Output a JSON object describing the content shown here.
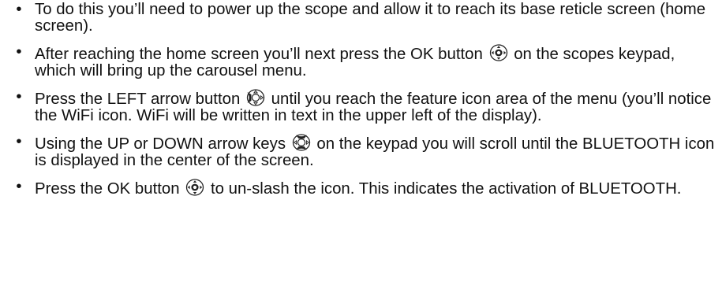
{
  "steps": [
    {
      "before": "To do this you’ll need to power up the scope and allow it to reach its base reticle screen (home screen).",
      "icon": null,
      "after": ""
    },
    {
      "before": "After reaching the home screen you’ll next press the OK button ",
      "icon": "keypad-ok-icon",
      "after": " on the scopes keypad, which will bring up the carousel menu."
    },
    {
      "before": "Press the LEFT arrow button ",
      "icon": "keypad-left-icon",
      "after": " until you reach the feature icon area of the menu (you’ll notice the WiFi icon. WiFi will be written in text in the upper left of the display)."
    },
    {
      "before": "Using the UP or DOWN arrow keys ",
      "icon": "keypad-up-down-icon",
      "after": " on the keypad you will scroll until the BLUETOOTH icon is displayed in the center of the screen."
    },
    {
      "before": "Press the OK button ",
      "icon": "keypad-ok-icon",
      "after": " to un-slash the icon. This indicates the activation of BLUETOOTH."
    }
  ],
  "bullet": "•"
}
